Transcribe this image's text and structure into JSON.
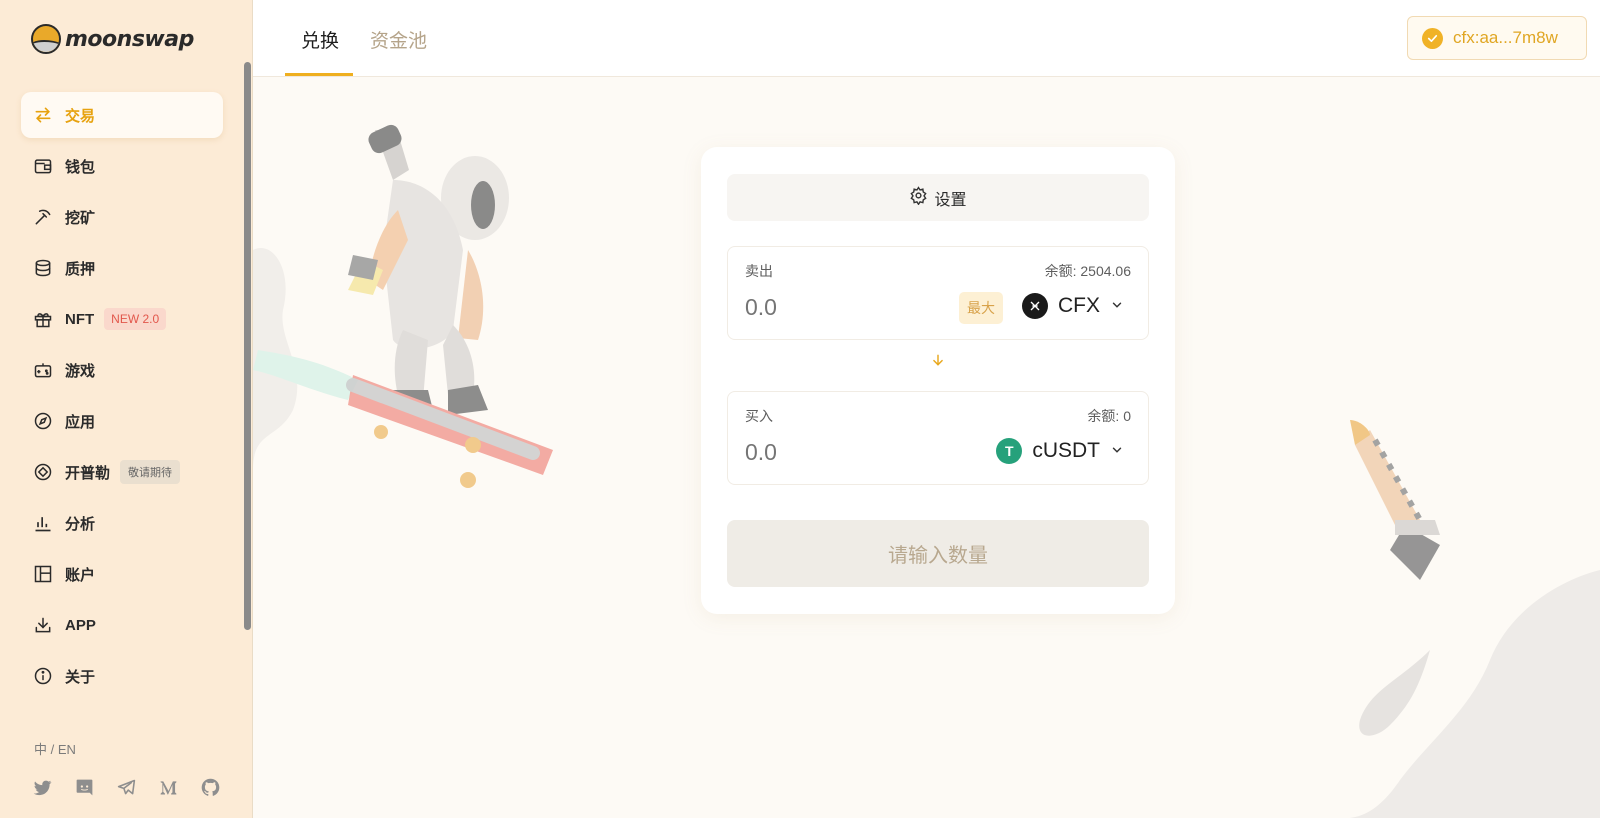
{
  "brand": {
    "logo_text": "moonswap"
  },
  "sidebar": {
    "items": [
      {
        "label": "交易",
        "icon": "swap-arrows-icon",
        "active": true
      },
      {
        "label": "钱包",
        "icon": "wallet-icon"
      },
      {
        "label": "挖矿",
        "icon": "pickaxe-icon"
      },
      {
        "label": "质押",
        "icon": "database-stack-icon"
      },
      {
        "label": "NFT",
        "icon": "gift-icon",
        "badge": "NEW 2.0"
      },
      {
        "label": "游戏",
        "icon": "gamepad-icon"
      },
      {
        "label": "应用",
        "icon": "compass-icon"
      },
      {
        "label": "开普勒",
        "icon": "diamond-circle-icon",
        "badge": "敬请期待"
      },
      {
        "label": "分析",
        "icon": "bar-chart-icon"
      },
      {
        "label": "账户",
        "icon": "layout-panel-icon"
      },
      {
        "label": "APP",
        "icon": "download-icon"
      },
      {
        "label": "关于",
        "icon": "info-icon"
      }
    ],
    "language": "中 / EN",
    "socials": [
      "twitter-icon",
      "discord-icon",
      "telegram-icon",
      "medium-icon",
      "github-icon"
    ]
  },
  "header": {
    "tabs": [
      {
        "label": "兑换",
        "active": true
      },
      {
        "label": "资金池",
        "active": false
      }
    ],
    "wallet_address": "cfx:aa...7m8w"
  },
  "swap": {
    "settings_label": "设置",
    "sell": {
      "label": "卖出",
      "balance": "余额: 2504.06",
      "placeholder": "0.0",
      "max_label": "最大",
      "token": "CFX"
    },
    "buy": {
      "label": "买入",
      "balance": "余额: 0",
      "placeholder": "0.0",
      "token": "cUSDT"
    },
    "submit_label": "请输入数量"
  },
  "colors": {
    "accent": "#efaf1f",
    "sidebar_bg": "#fcebd6",
    "page_bg": "#fdfaf5"
  }
}
